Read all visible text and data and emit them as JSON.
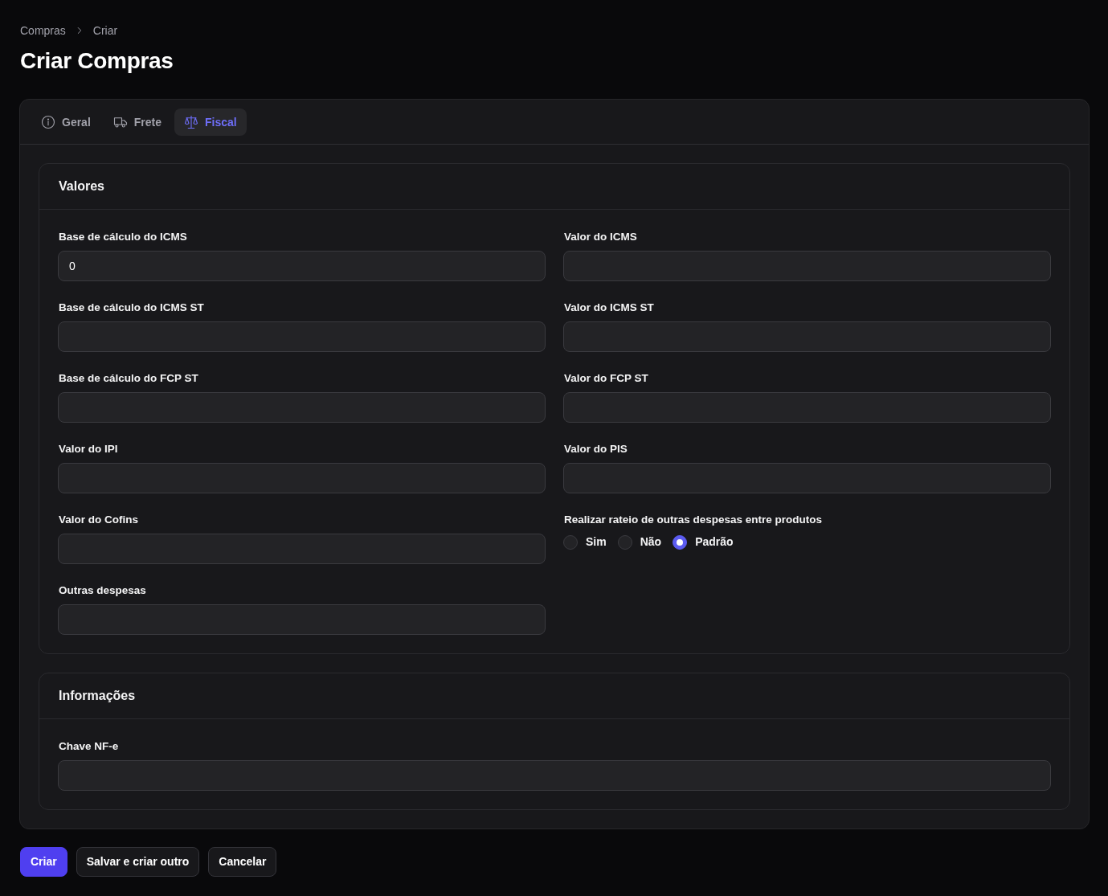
{
  "breadcrumbs": [
    {
      "label": "Compras"
    },
    {
      "label": "Criar"
    }
  ],
  "title": "Criar Compras",
  "tabs": [
    {
      "label": "Geral",
      "selected": false
    },
    {
      "label": "Frete",
      "selected": false
    },
    {
      "label": "Fiscal",
      "selected": true
    }
  ],
  "sections": [
    {
      "title": "Valores",
      "fields": [
        {
          "kind": "input",
          "label": "Base de cálculo do ICMS",
          "value": "0"
        },
        {
          "kind": "input",
          "label": "Valor do ICMS"
        },
        {
          "kind": "input",
          "label": "Base de cálculo do ICMS ST"
        },
        {
          "kind": "input",
          "label": "Valor do ICMS ST"
        },
        {
          "kind": "input",
          "label": "Base de cálculo do FCP ST"
        },
        {
          "kind": "input",
          "label": "Valor do FCP ST"
        },
        {
          "kind": "input",
          "label": "Valor do IPI"
        },
        {
          "kind": "input",
          "label": "Valor do PIS"
        },
        {
          "kind": "input",
          "label": "Valor do Cofins"
        },
        {
          "kind": "radio",
          "label": "Realizar rateio de outras despesas entre produtos",
          "options": [
            {
              "label": "Sim",
              "selected": false
            },
            {
              "label": "Não",
              "selected": false
            },
            {
              "label": "Padrão",
              "selected": true
            }
          ]
        },
        {
          "kind": "input",
          "label": "Outras despesas"
        }
      ]
    },
    {
      "title": "Informações",
      "fields": [
        {
          "kind": "input",
          "label": "Chave NF-e"
        }
      ]
    }
  ],
  "buttons": [
    {
      "label": "Criar",
      "kind": "primary"
    },
    {
      "label": "Salvar e criar outro",
      "kind": "secondary"
    },
    {
      "label": "Cancelar",
      "kind": "secondary"
    }
  ]
}
